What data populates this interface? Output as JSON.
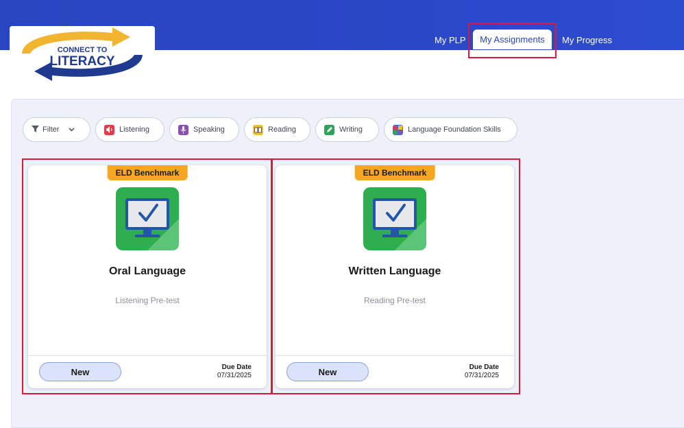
{
  "header": {
    "logo": {
      "line1": "CONNECT TO",
      "line2": "LITERACY",
      "colors": {
        "gold": "#f2b530",
        "navy": "#1f3a8f"
      }
    },
    "nav": [
      {
        "label": "My PLP"
      },
      {
        "label": "My Assignments",
        "active": true
      },
      {
        "label": "My Progress"
      }
    ],
    "accent": "#2a45c0",
    "highlight_color": "#e0163c"
  },
  "filters": {
    "filter_label": "Filter",
    "chips": [
      {
        "label": "Listening",
        "icon": "speaker-icon",
        "color": "#e23b4a"
      },
      {
        "label": "Speaking",
        "icon": "microphone-icon",
        "color": "#8b4fb8"
      },
      {
        "label": "Reading",
        "icon": "book-icon",
        "color": "#f2c12e"
      },
      {
        "label": "Writing",
        "icon": "pencil-icon",
        "color": "#2fa35a"
      },
      {
        "label": "Language Foundation Skills",
        "icon": "blocks-icon",
        "color": "#3a6fd8"
      }
    ]
  },
  "assignments": [
    {
      "badge": "ELD Benchmark",
      "title": "Oral Language",
      "subtitle": "Listening Pre-test",
      "status": "New",
      "due_label": "Due Date",
      "due_date": "07/31/2025",
      "icon": "monitor-check-icon"
    },
    {
      "badge": "ELD Benchmark",
      "title": "Written Language",
      "subtitle": "Reading Pre-test",
      "status": "New",
      "due_label": "Due Date",
      "due_date": "07/31/2025",
      "icon": "monitor-check-icon"
    }
  ]
}
